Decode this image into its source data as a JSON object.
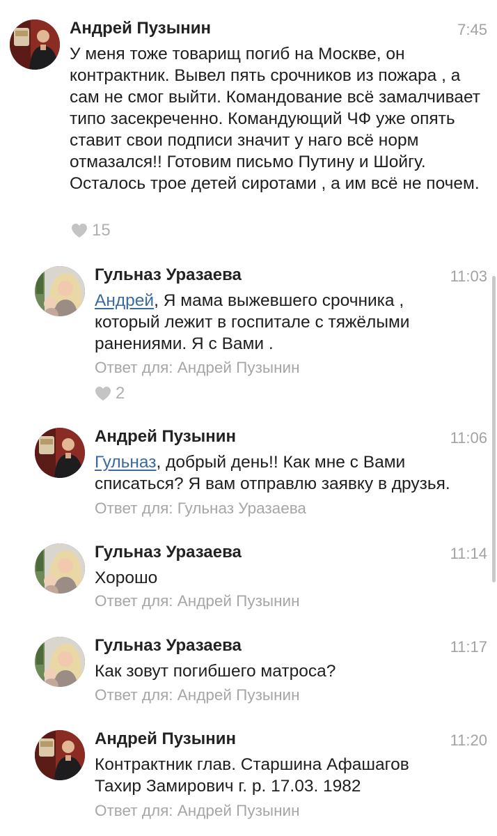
{
  "comments": [
    {
      "author": "Андрей Пузынин",
      "time": "7:45",
      "text": "У меня тоже товарищ погиб на Москве, он контрактник. Вывел пять срочников из пожара , а сам не смог выйти. Командование всё замалчивает типо засекреченно. Командующий ЧФ уже опять ставит свои подписи значит у наго всё норм отмазался!! Готовим письмо Путину и Шойгу. Осталось трое детей сиротами , а им всё не почем.",
      "likes": "15"
    },
    {
      "author": "Гульназ Уразаева",
      "time": "11:03",
      "mention": "Андрей",
      "text": ", Я мама выжевшего срочника , который лежит в госпитале с тяжёлыми ранениями.  Я с Вами .",
      "reply_to": "Ответ для: Андрей Пузынин",
      "likes": "2"
    },
    {
      "author": "Андрей Пузынин",
      "time": "11:06",
      "mention": "Гульназ",
      "text": ", добрый день!! Как мне с Вами списаться? Я вам отправлю заявку в друзья.",
      "reply_to": "Ответ для: Гульназ Уразаева"
    },
    {
      "author": "Гульназ Уразаева",
      "time": "11:14",
      "text": "Хорошо",
      "reply_to": "Ответ для: Андрей Пузынин"
    },
    {
      "author": "Гульназ Уразаева",
      "time": "11:17",
      "text": "Как зовут погибшего матроса?",
      "reply_to": "Ответ для: Андрей Пузынин"
    },
    {
      "author": "Андрей Пузынин",
      "time": "11:20",
      "text": "Контрактник глав. Старшина Афашагов Тахир Замирович  г. р. 17.03. 1982",
      "reply_to": "Ответ для: Андрей Пузынин"
    }
  ],
  "icons": {
    "like": "heart-icon",
    "avatar_andrey": "avatar-photo",
    "avatar_gulnaz": "avatar-photo"
  },
  "colors": {
    "mention": "#3b6aa0",
    "meta": "#a6a6a6",
    "like": "#c4c4c4"
  }
}
